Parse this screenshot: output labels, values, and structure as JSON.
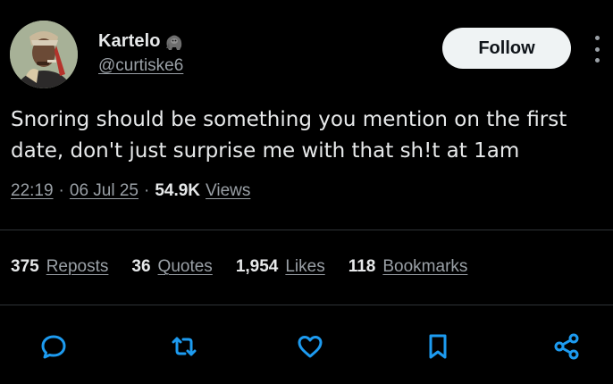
{
  "author": {
    "display_name": "Kartelo",
    "badge_icon": "gorilla-emoji-icon",
    "handle": "@curtiske6"
  },
  "follow_label": "Follow",
  "tweet": {
    "text": "Snoring should be something you mention on the first\ndate, don't just surprise me with that sh!t at 1am",
    "time": "22:19",
    "date": "06 Jul 25",
    "views_count": "54.9K",
    "views_label": "Views"
  },
  "stats": [
    {
      "count": "375",
      "label": "Reposts"
    },
    {
      "count": "36",
      "label": "Quotes"
    },
    {
      "count": "1,954",
      "label": "Likes"
    },
    {
      "count": "118",
      "label": "Bookmarks"
    }
  ],
  "actions": [
    {
      "name": "reply",
      "icon": "speech-bubble-icon"
    },
    {
      "name": "repost",
      "icon": "repost-arrows-icon"
    },
    {
      "name": "like",
      "icon": "heart-icon"
    },
    {
      "name": "bookmark",
      "icon": "bookmark-icon"
    },
    {
      "name": "share",
      "icon": "share-icon"
    }
  ],
  "colors": {
    "background": "#000000",
    "text_primary": "#e7e9ea",
    "text_secondary": "#9aa0a6",
    "divider": "#2f3336",
    "follow_bg": "#eff3f4"
  }
}
